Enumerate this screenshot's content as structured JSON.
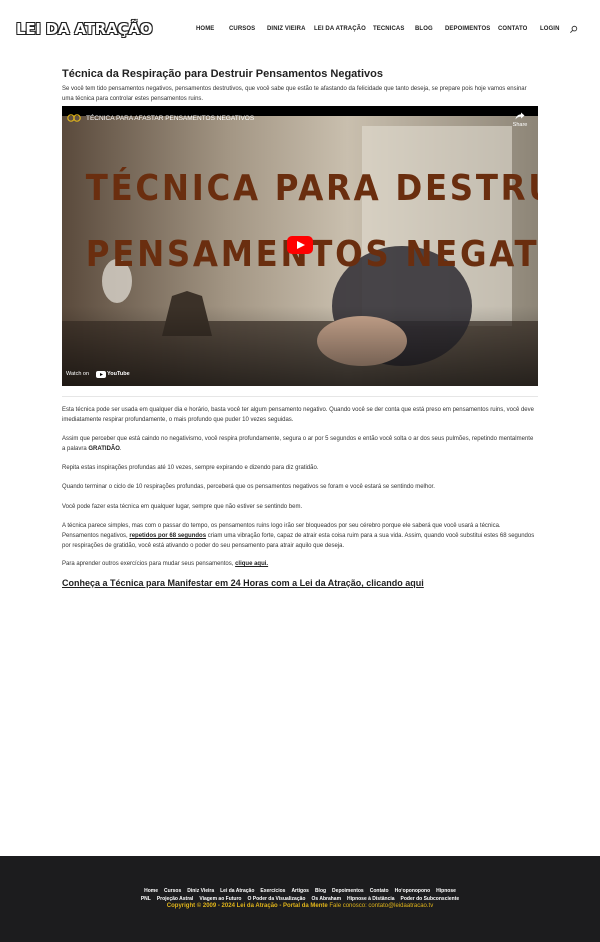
{
  "header": {
    "logo": "LEI DA ATRAÇÃO",
    "nav": [
      "Home",
      "Cursos",
      "Diniz Vieira",
      "Lei da Atração",
      "Tecnicas",
      "Blog",
      "Depoimentos",
      "Contato",
      "Login"
    ],
    "search_icon": "search-icon"
  },
  "article": {
    "title": "Técnica da Respiração para Destruir Pensamentos Negativos",
    "intro": "Se você tem tido pensamentos negativos, pensamentos destrutivos, que você sabe que estão te afastando da felicidade que tanto deseja, se prepare pois hoje vamos ensinar uma técnica para controlar estes pensamentos ruins.",
    "video": {
      "title": "TÉCNICA PARA AFASTAR PENSAMENTOS NEGATIVOS",
      "share": "Share",
      "overlay_line1": "TÉCNICA PARA DESTRUIR",
      "overlay_line2": "PENSAMENTOS NEGATIVOS",
      "watch_on": "Watch on",
      "youtube": "YouTube"
    },
    "p1": "Esta técnica pode ser usada em qualquer dia e horário, basta você ter algum pensamento negativo. Quando você se der conta que está preso em pensamentos ruins, você deve imediatamente respirar profundamente, o mais profundo que puder 10 vezes seguidas.",
    "p2a": "Assim que perceber que está caindo no negativismo, você respira profundamente, segura o ar por 5 segundos e então você solta o ar dos seus pulmões, repetindo mentalmente a palavra ",
    "p2b": "GRATIDÃO",
    "p2c": ".",
    "p3": "Repita estas inspirações profundas até 10 vezes, sempre expirando e dizendo para diz gratidão.",
    "p4": "Quando terminar o ciclo de 10 respirações profundas, perceberá que os pensamentos negativos se foram e você estará se sentindo melhor.",
    "p5": "Você pode fazer esta técnica em qualquer lugar, sempre que não estiver se sentindo bem.",
    "p6a": "A técnica parece simples, mas com o passar do tempo, os pensamentos ruins logo irão ser bloqueados por seu cérebro porque ele saberá que você usará a técnica. Pensamentos negativos, ",
    "p6b": "repetidos por 68 segundos",
    "p6c": " criam uma vibração forte, capaz de atrair esta coisa ruim para a sua vida. Assim, quando você substitui estes 68 segundos por respirações de gratidão, você está ativando o poder do seu pensamento para atrair aquilo que deseja.",
    "p7a": "Para aprender outros exercícios para mudar seus pensamentos, ",
    "p7b": "clique aqui.",
    "cta": "Conheça a Técnica para Manifestar em 24 Horas com a Lei da Atração, clicando aqui"
  },
  "footer": {
    "row1": [
      "Home",
      "Cursos",
      "Diniz Vieira",
      "Lei da Atração",
      "Exercícios",
      "Artigos",
      "Blog",
      "Depoimentos",
      "Contato",
      "Hoʻoponopono",
      "Hipnose"
    ],
    "row2": [
      "PNL",
      "Projeção Astral",
      "Viagem ao Futuro",
      "O Poder da Visualização",
      "Os Abraham",
      "Hipnose à Distância",
      "Poder do Subconsciente"
    ],
    "copyright": "Copyright © 2009 - 2024 Lei da Atração - Portal da Mente",
    "contact": " Fale conosco: contato@leidaatracao.tv"
  },
  "colors": {
    "footer_bg": "#1c1c1e",
    "footer_accent": "#e0b41a",
    "overlay_text": "#6a2e0f",
    "play_button": "#ff0000"
  }
}
